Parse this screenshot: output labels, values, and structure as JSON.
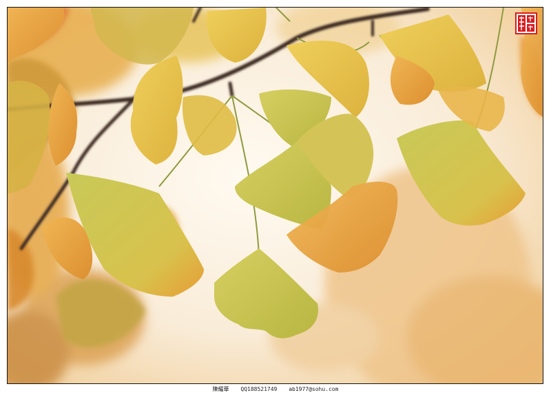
{
  "photo": {
    "subject": "ginkgo leaves on a branch",
    "colors": {
      "background_light": "#fbf3e6",
      "background_warm": "#eebf7a",
      "leaf_green": "#c9c655",
      "leaf_yellow": "#e9c04a",
      "leaf_orange": "#e7a33c",
      "branch": "#3d2a22"
    }
  },
  "seal": {
    "text": "陳耀華",
    "color": "#d41e22"
  },
  "caption": {
    "name": "陳耀華",
    "qq": "QQ188521749",
    "email": "ab1977@sohu.com"
  }
}
